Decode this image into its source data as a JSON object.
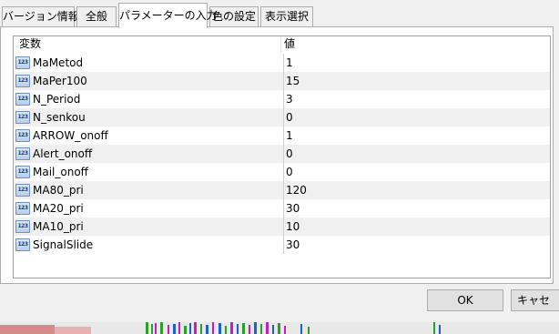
{
  "tabs": [
    {
      "label": "バージョン情報"
    },
    {
      "label": "全般"
    },
    {
      "label": "パラメーターの入力"
    },
    {
      "label": "色の設定"
    },
    {
      "label": "表示選択"
    }
  ],
  "table": {
    "col_variable": "変数",
    "col_value": "値",
    "icon_text": "123",
    "rows": [
      {
        "name": "MaMetod",
        "value": "1"
      },
      {
        "name": "MaPer100",
        "value": "15"
      },
      {
        "name": "N_Period",
        "value": "3"
      },
      {
        "name": "N_senkou",
        "value": "0"
      },
      {
        "name": "ARROW_onoff",
        "value": "1"
      },
      {
        "name": "Alert_onoff",
        "value": "0"
      },
      {
        "name": "Mail_onoff",
        "value": "0"
      },
      {
        "name": "MA80_pri",
        "value": "120"
      },
      {
        "name": "MA20_pri",
        "value": "30"
      },
      {
        "name": "MA10_pri",
        "value": "10"
      },
      {
        "name": "SignalSlide",
        "value": "30"
      }
    ]
  },
  "buttons": {
    "ok": "OK",
    "cancel": "キャセ"
  }
}
